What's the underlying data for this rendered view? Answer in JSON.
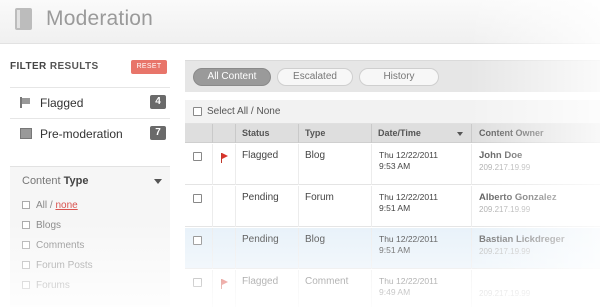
{
  "header": {
    "title": "Moderation",
    "icon": "document-icon"
  },
  "sidebar": {
    "filter_label_bold": "FILTER",
    "filter_label_rest": "RESULTS",
    "reset_label": "RESET",
    "items": [
      {
        "label": "Flagged",
        "count": "4",
        "icon": "flag-list-icon"
      },
      {
        "label": "Pre-moderation",
        "count": "7",
        "icon": "pre-moderation-icon"
      }
    ],
    "content_type": {
      "label_light": "Content",
      "label_bold": "Type",
      "all_label": "All /",
      "none_label": "none",
      "items": [
        "Blogs",
        "Comments",
        "Forum Posts",
        "Forums"
      ]
    }
  },
  "tabs": [
    {
      "label": "All Content",
      "active": true
    },
    {
      "label": "Escalated",
      "active": false
    },
    {
      "label": "History",
      "active": false
    }
  ],
  "select_all_label": "Select All / None",
  "table": {
    "columns": [
      "Status",
      "Type",
      "Date/Time",
      "Content Owner"
    ],
    "rows": [
      {
        "flag": true,
        "status": "Flagged",
        "type": "Blog",
        "date": "Thu 12/22/2011",
        "time": "9:53 AM",
        "owner": "John Doe",
        "ip": "209.217.19.99"
      },
      {
        "flag": false,
        "status": "Pending",
        "type": "Forum",
        "date": "Thu 12/22/2011",
        "time": "9:51 AM",
        "owner": "Alberto Gonzalez",
        "ip": "209.217.19.99"
      },
      {
        "flag": false,
        "status": "Pending",
        "type": "Blog",
        "date": "Thu 12/22/2011",
        "time": "9:51 AM",
        "owner": "Bastian Lickdreger",
        "ip": "209.217.19.99"
      },
      {
        "flag": true,
        "status": "Flagged",
        "type": "Comment",
        "date": "Thu 12/22/2011",
        "time": "9:49 AM",
        "owner": "",
        "ip": "209.217.19.99"
      }
    ]
  },
  "colors": {
    "accent_reset": "#e8756a",
    "flag": "#d9342b",
    "highlight_row": "#e7f1f9",
    "none_link": "#d9534f"
  }
}
